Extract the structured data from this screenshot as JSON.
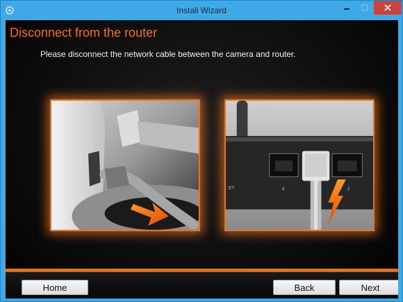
{
  "window": {
    "title": "Install Wizard"
  },
  "page": {
    "heading": "Disconnect from the router",
    "instruction": "Please disconnect the network cable between the camera and router."
  },
  "images": {
    "left": "camera-cable-photo",
    "right": "router-ports-photo"
  },
  "right_photo_labels": {
    "port_left": "ET",
    "port_4": "4",
    "port_2": "2"
  },
  "footer": {
    "home_label": "Home",
    "back_label": "Back",
    "next_label": "Next"
  },
  "colors": {
    "accent": "#ff6a1a",
    "titlebar": "#3fa9e8",
    "close": "#c7453a"
  }
}
